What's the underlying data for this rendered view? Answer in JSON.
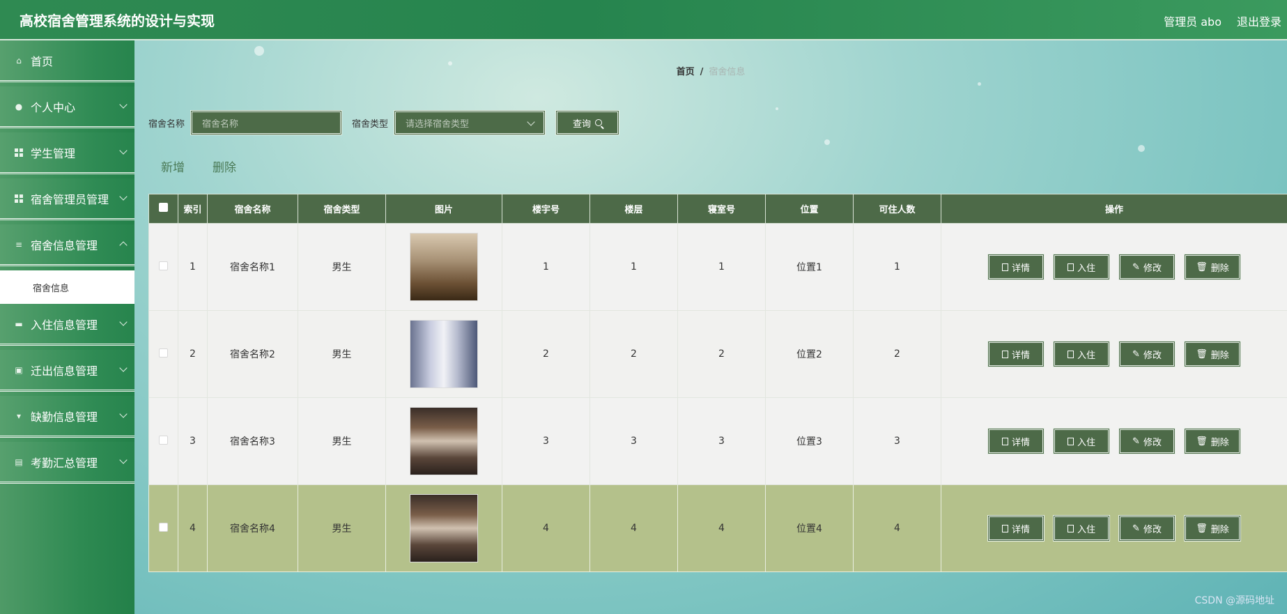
{
  "header": {
    "title": "高校宿舍管理系统的设计与实现",
    "user": "管理员 abo",
    "logout": "退出登录"
  },
  "sidebar": {
    "items": [
      {
        "label": "首页"
      },
      {
        "label": "个人中心"
      },
      {
        "label": "学生管理"
      },
      {
        "label": "宿舍管理员管理"
      },
      {
        "label": "宿舍信息管理",
        "sub": "宿舍信息"
      },
      {
        "label": "入住信息管理"
      },
      {
        "label": "迁出信息管理"
      },
      {
        "label": "缺勤信息管理"
      },
      {
        "label": "考勤汇总管理"
      }
    ]
  },
  "breadcrumb": {
    "home": "首页",
    "sep": "/",
    "current": "宿舍信息"
  },
  "search": {
    "name_label": "宿舍名称",
    "name_placeholder": "宿舍名称",
    "type_label": "宿舍类型",
    "type_placeholder": "请选择宿舍类型",
    "query": "查询"
  },
  "actions": {
    "add": "新增",
    "delete": "删除"
  },
  "table": {
    "headers": [
      "",
      "索引",
      "宿舍名称",
      "宿舍类型",
      "图片",
      "楼宇号",
      "楼层",
      "寝室号",
      "位置",
      "可住人数",
      "操作"
    ],
    "rows": [
      {
        "index": "1",
        "name": "宿舍名称1",
        "type": "男生",
        "building": "1",
        "floor": "1",
        "room": "1",
        "location": "位置1",
        "capacity": "1"
      },
      {
        "index": "2",
        "name": "宿舍名称2",
        "type": "男生",
        "building": "2",
        "floor": "2",
        "room": "2",
        "location": "位置2",
        "capacity": "2"
      },
      {
        "index": "3",
        "name": "宿舍名称3",
        "type": "男生",
        "building": "3",
        "floor": "3",
        "room": "3",
        "location": "位置3",
        "capacity": "3"
      },
      {
        "index": "4",
        "name": "宿舍名称4",
        "type": "男生",
        "building": "4",
        "floor": "4",
        "room": "4",
        "location": "位置4",
        "capacity": "4"
      }
    ],
    "ops": {
      "detail": "详情",
      "checkin": "入住",
      "edit": "修改",
      "delete": "删除"
    }
  },
  "watermark": "CSDN @源码地址"
}
